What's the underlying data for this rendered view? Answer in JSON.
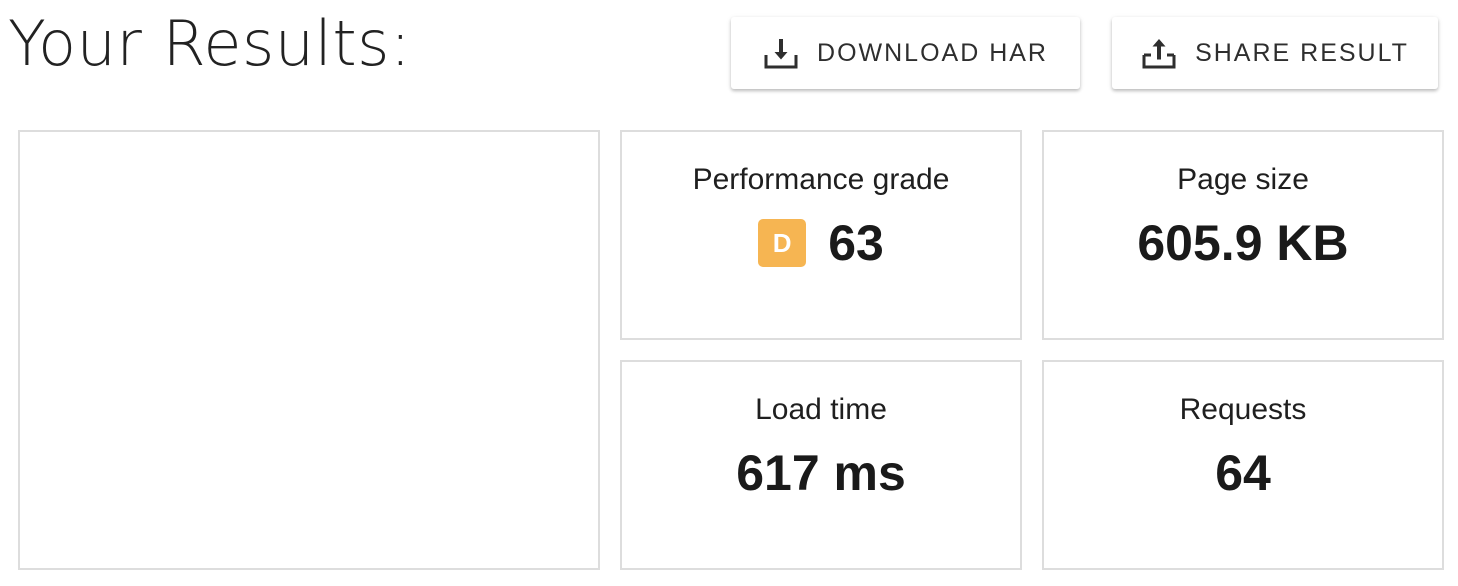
{
  "header": {
    "title": "Your Results:"
  },
  "actions": {
    "download_label": "DOWNLOAD HAR",
    "download_icon": "download-icon",
    "share_label": "SHARE RESULT",
    "share_icon": "share-icon"
  },
  "metrics": {
    "performance": {
      "label": "Performance grade",
      "grade": "D",
      "grade_color": "#f6b552",
      "value": "63"
    },
    "page_size": {
      "label": "Page size",
      "value": "605.9 KB"
    },
    "load_time": {
      "label": "Load time",
      "value": "617 ms"
    },
    "requests": {
      "label": "Requests",
      "value": "64"
    }
  }
}
